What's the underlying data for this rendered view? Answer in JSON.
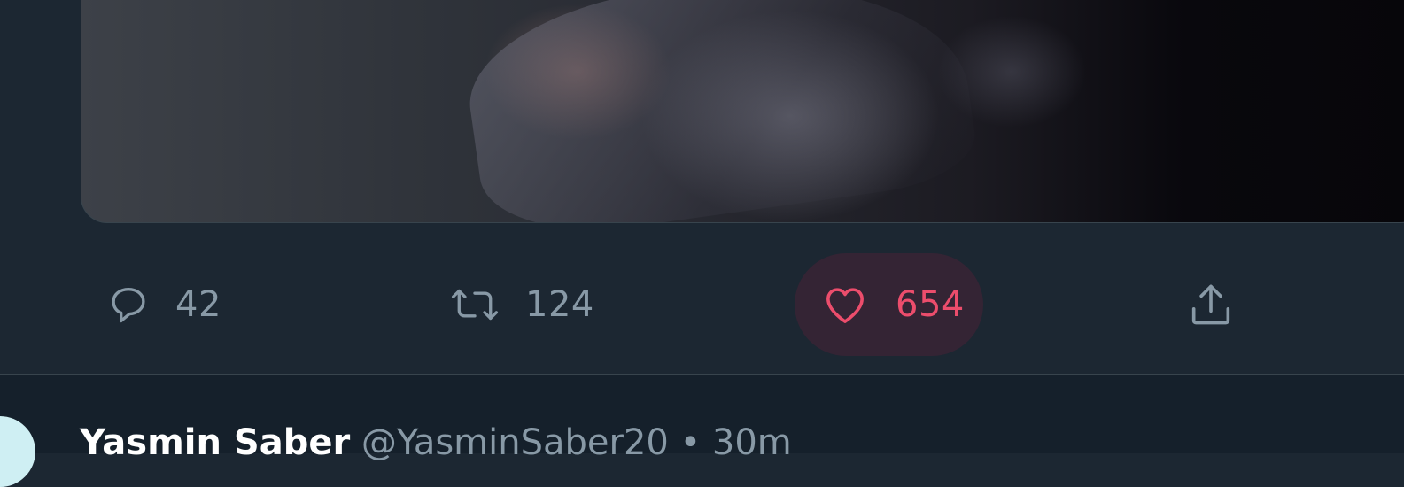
{
  "tweet": {
    "actions": {
      "reply": {
        "icon": "reply-icon",
        "count": "42"
      },
      "retweet": {
        "icon": "retweet-icon",
        "count": "124"
      },
      "like": {
        "icon": "heart-icon",
        "count": "654",
        "active": true
      },
      "share": {
        "icon": "share-icon"
      }
    }
  },
  "next_tweet": {
    "author_name": "Yasmin Saber",
    "handle": "@YasminSaber20",
    "separator": "•",
    "time": "30m"
  },
  "colors": {
    "background": "#1c2732",
    "border": "#38444d",
    "muted_text": "#8899a6",
    "like_red": "#ec4d6c",
    "like_highlight": "#342434"
  }
}
